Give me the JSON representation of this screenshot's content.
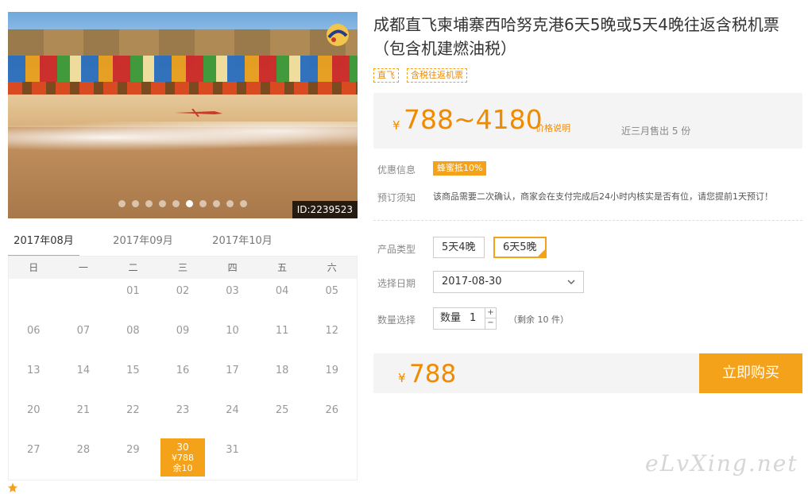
{
  "hero": {
    "image_id": "ID:2239523",
    "slides": [
      0,
      1,
      2,
      3,
      4,
      5,
      6,
      7,
      8,
      9
    ],
    "active_slide": 5
  },
  "calendar": {
    "months": [
      "2017年08月",
      "2017年09月",
      "2017年10月"
    ],
    "active_month": 0,
    "weekdays": [
      "日",
      "一",
      "二",
      "三",
      "四",
      "五",
      "六"
    ],
    "days": [
      "",
      "",
      "01",
      "02",
      "03",
      "04",
      "05",
      "06",
      "07",
      "08",
      "09",
      "10",
      "11",
      "12",
      "13",
      "14",
      "15",
      "16",
      "17",
      "18",
      "19",
      "20",
      "21",
      "22",
      "23",
      "24",
      "25",
      "26",
      "27",
      "28",
      "29",
      "30",
      "31",
      "",
      ""
    ],
    "selected": {
      "day": "30",
      "price": "¥788",
      "remain": "余10"
    }
  },
  "product": {
    "title": "成都直飞柬埔寨西哈努克港6天5晚或5天4晚往返含税机票（包含机建燃油税）",
    "tags": [
      "直飞",
      "含税往返机票"
    ],
    "currency": "¥",
    "price_range": "788~4180",
    "price_note": "价格说明",
    "sold": "近三月售出 5 份"
  },
  "info": {
    "promo_label": "优惠信息",
    "promo_badge": "蜂蜜抵10%",
    "notice_label": "预订须知",
    "notice_text": "该商品需要二次确认，商家会在支付完成后24小时内核实是否有位，请您提前1天预订！"
  },
  "options": {
    "type_label": "产品类型",
    "types": [
      "5天4晚",
      "6天5晚"
    ],
    "selected_type": 1,
    "date_label": "选择日期",
    "date_value": "2017-08-30",
    "qty_label": "数量选择",
    "qty_field_label": "数量",
    "qty_value": "1",
    "remain": "（剩余 10 件）"
  },
  "buy": {
    "currency": "¥",
    "total": "788",
    "button": "立即购买"
  },
  "watermark": "eLvXing.net",
  "colors": {
    "accent": "#f5a21b",
    "price": "#f08a00"
  }
}
